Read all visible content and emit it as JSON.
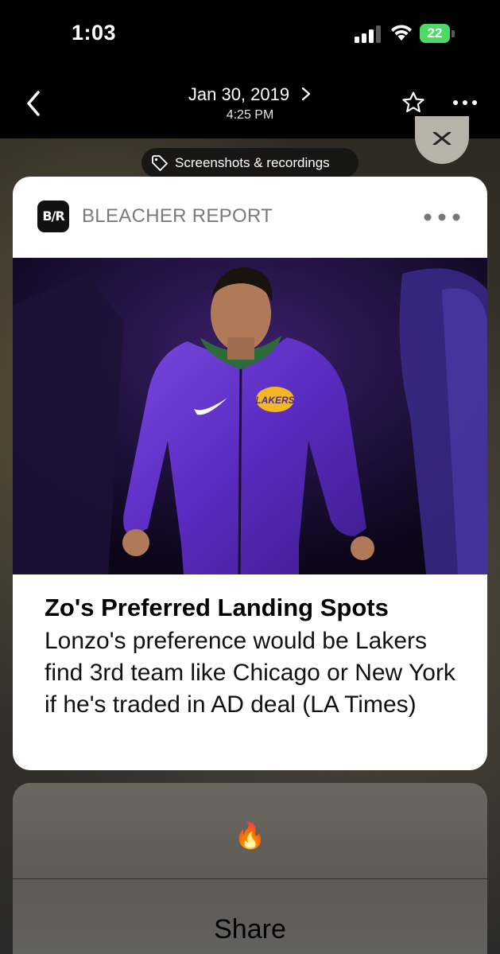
{
  "status_bar": {
    "time": "1:03",
    "battery": "22"
  },
  "nav": {
    "date": "Jan 30, 2019",
    "time": "4:25 PM"
  },
  "tag": {
    "label": "Screenshots & recordings"
  },
  "notification": {
    "app_icon_text": "B/R",
    "app_name": "BLEACHER REPORT",
    "title": "Zo's Preferred Landing Spots",
    "body": "Lonzo's preference would be Lakers find 3rd team like Chicago or New York if he's traded in AD deal (LA Times)",
    "image_text": "LAKERS"
  },
  "reaction": {
    "emoji": "🔥",
    "share_label": "Share"
  },
  "icons": [
    "back-chevron-icon",
    "forward-chevron-icon",
    "star-icon",
    "more-icon",
    "close-icon",
    "tag-icon",
    "signal-icon",
    "wifi-icon",
    "battery-icon"
  ],
  "colors": {
    "battery": "#4cd964",
    "lakers_purple": "#5a2bc0",
    "lakers_gold": "#f2b824"
  }
}
